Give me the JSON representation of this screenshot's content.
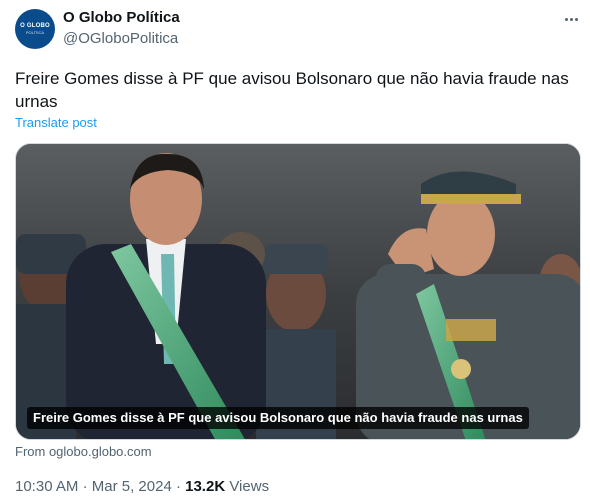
{
  "author": {
    "name": "O Globo Política",
    "handle": "@OGloboPolitica",
    "avatar_text": "O GLOBO",
    "avatar_subtext": "POLÍTICA"
  },
  "post": {
    "text": "Freire Gomes disse à PF que avisou Bolsonaro que não havia fraude nas urnas",
    "translate_label": "Translate post"
  },
  "media": {
    "caption": "Freire Gomes disse à PF que avisou Bolsonaro que não havia fraude nas urnas",
    "source": "From oglobo.globo.com"
  },
  "meta": {
    "time": "10:30 AM",
    "separator": "·",
    "date": "Mar 5, 2024",
    "views_count": "13.2K",
    "views_label": "Views"
  },
  "icons": {
    "more": "more-options-icon"
  }
}
